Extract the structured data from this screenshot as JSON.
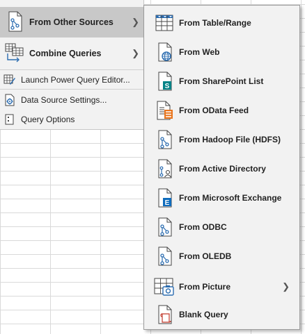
{
  "left_menu": {
    "items": [
      {
        "label": "From Other Sources",
        "has_submenu": true,
        "active": true
      },
      {
        "label": "Combine Queries",
        "has_submenu": true
      },
      {
        "label": "Launch Power Query Editor..."
      },
      {
        "label": "Data Source Settings..."
      },
      {
        "label": "Query Options"
      }
    ]
  },
  "submenu": {
    "items": [
      {
        "label": "From Table/Range",
        "icon": "table-range-icon"
      },
      {
        "label": "From Web",
        "icon": "web-icon"
      },
      {
        "label": "From SharePoint List",
        "icon": "sharepoint-icon"
      },
      {
        "label": "From OData Feed",
        "icon": "odata-icon"
      },
      {
        "label": "From Hadoop File (HDFS)",
        "icon": "hadoop-icon"
      },
      {
        "label": "From Active Directory",
        "icon": "active-directory-icon"
      },
      {
        "label": "From Microsoft Exchange",
        "icon": "exchange-icon"
      },
      {
        "label": "From ODBC",
        "icon": "odbc-icon"
      },
      {
        "label": "From OLEDB",
        "icon": "oledb-icon"
      },
      {
        "label": "From Picture",
        "icon": "picture-icon",
        "has_submenu": true
      },
      {
        "label": "Blank Query",
        "icon": "blank-query-icon"
      }
    ]
  },
  "colors": {
    "menu_bg": "#f2f2f2",
    "active_bg": "#c8c8c8",
    "accent_blue": "#2b6cb0",
    "sharepoint_teal": "#038387",
    "odata_orange": "#e8741c",
    "exchange_blue": "#0f6cbd"
  }
}
